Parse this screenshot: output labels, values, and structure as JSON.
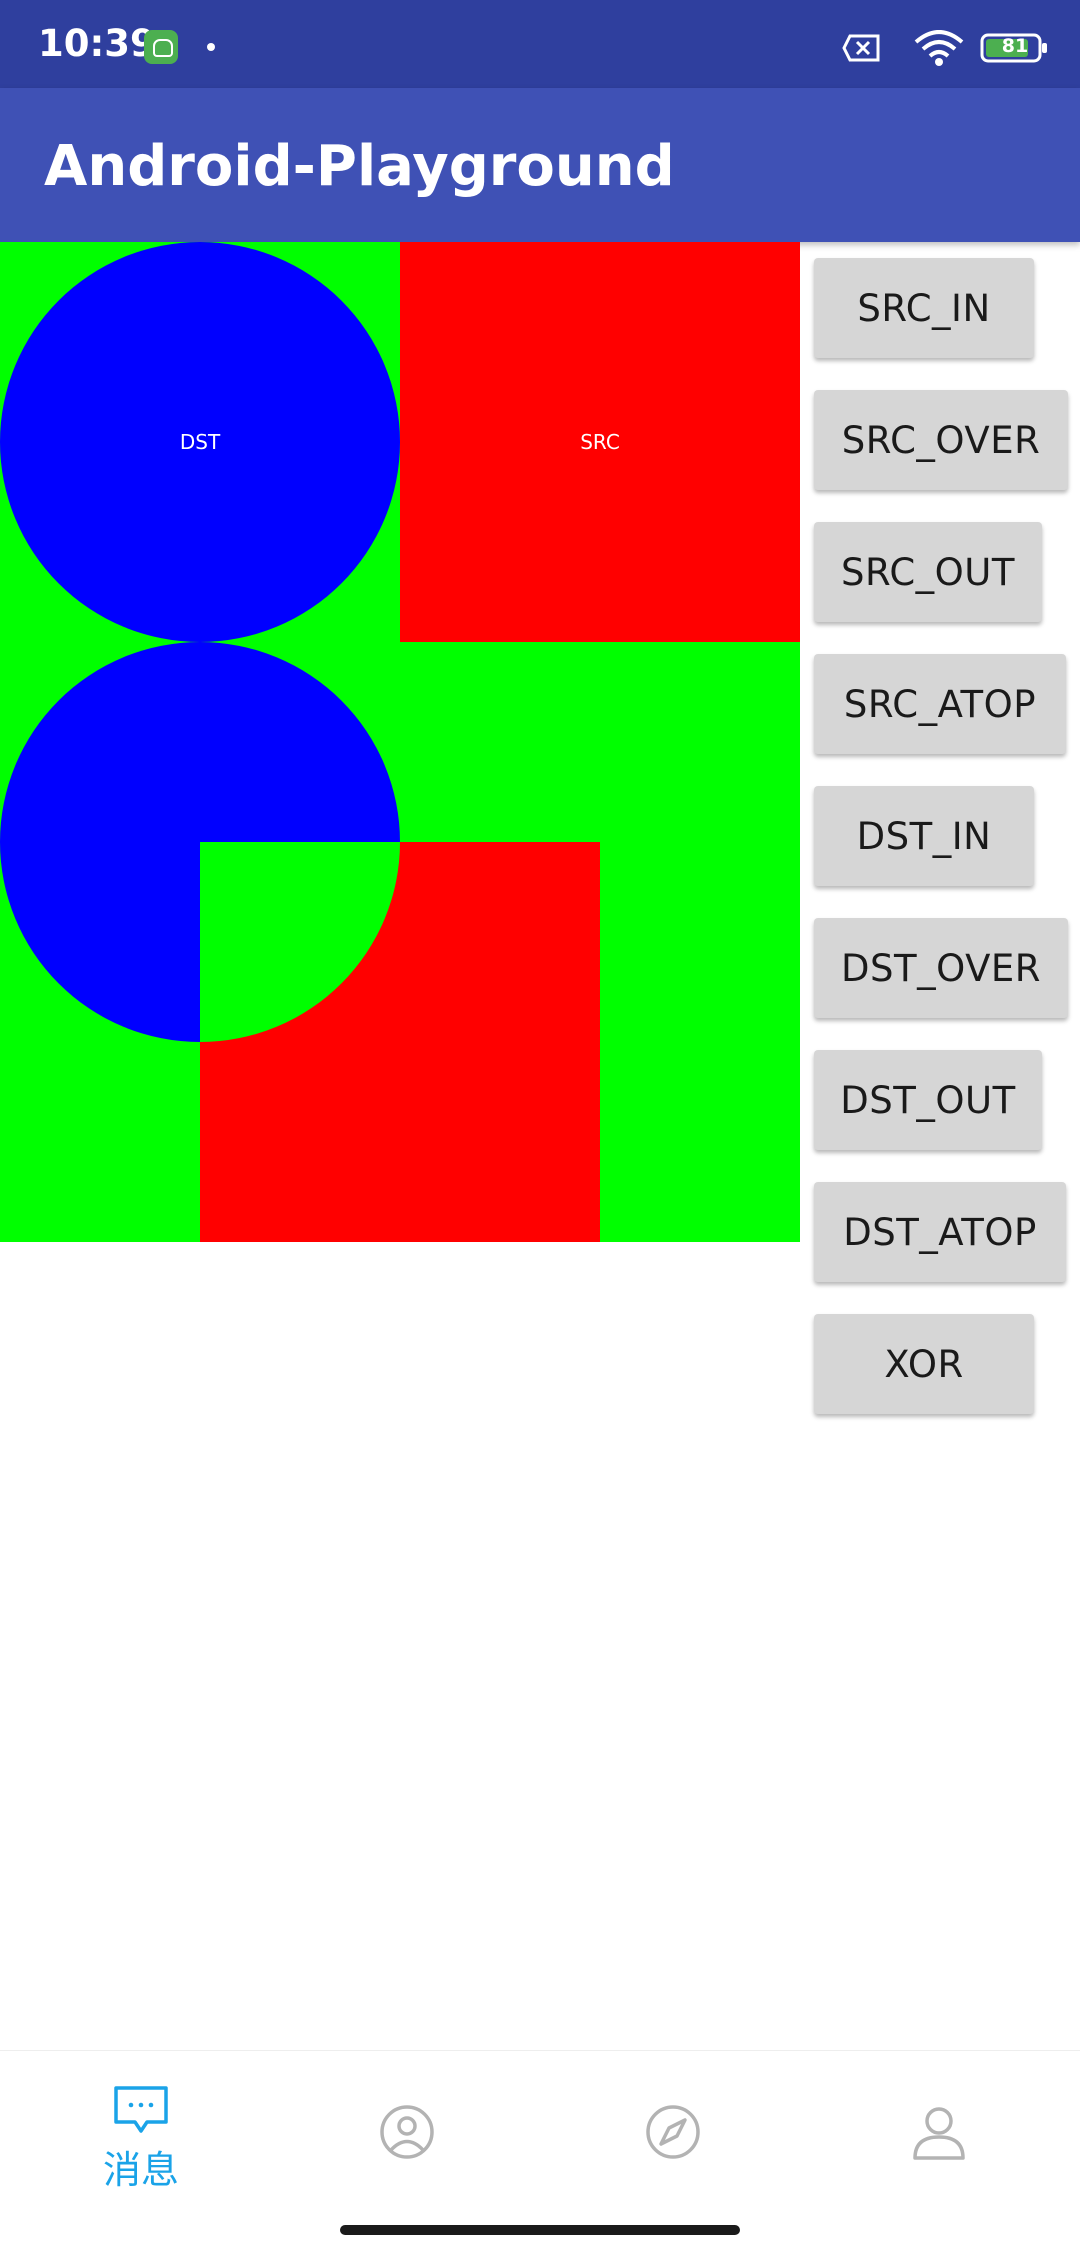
{
  "status_bar": {
    "time": "10:39",
    "battery": "81",
    "icons": [
      "app-notification-icon",
      "notification-dot",
      "sim-off-icon",
      "wifi-icon",
      "battery-icon"
    ]
  },
  "app_bar": {
    "title": "Android-Playground",
    "color": "#3f51b5"
  },
  "canvas": {
    "background_color": "#00ff00",
    "dst_color": "#0000ff",
    "src_color": "#ff0000",
    "dst_label": "DST",
    "src_label": "SRC"
  },
  "modes": [
    {
      "label": "SRC_IN"
    },
    {
      "label": "SRC_OVER"
    },
    {
      "label": "SRC_OUT"
    },
    {
      "label": "SRC_ATOP"
    },
    {
      "label": "DST_IN"
    },
    {
      "label": "DST_OVER"
    },
    {
      "label": "DST_OUT"
    },
    {
      "label": "DST_ATOP"
    },
    {
      "label": "XOR"
    }
  ],
  "bottom_nav": {
    "active_color": "#1aa3e8",
    "inactive_color": "#b3b3b3",
    "tabs": [
      {
        "label": "消息",
        "icon": "message-icon",
        "active": true
      },
      {
        "label": "",
        "icon": "contacts-icon",
        "active": false
      },
      {
        "label": "",
        "icon": "compass-icon",
        "active": false
      },
      {
        "label": "",
        "icon": "profile-icon",
        "active": false
      }
    ]
  }
}
